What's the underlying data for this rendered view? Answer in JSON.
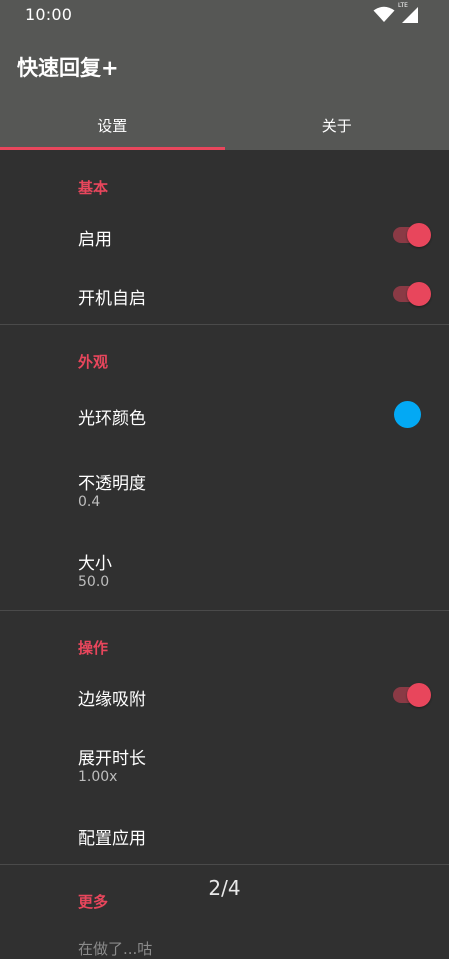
{
  "status_bar": {
    "time": "10:00",
    "network_label": "LTE",
    "icons": [
      "wifi-icon",
      "cell-signal-icon"
    ]
  },
  "app": {
    "title": "快速回复+",
    "accent_color": "#e8465c"
  },
  "tabs": [
    {
      "label": "设置",
      "selected": true
    },
    {
      "label": "关于",
      "selected": false
    }
  ],
  "sections": {
    "basic": {
      "header": "基本",
      "enable": {
        "title": "启用",
        "on": true
      },
      "autostart": {
        "title": "开机自启",
        "on": true
      }
    },
    "appearance": {
      "header": "外观",
      "halo_color": {
        "title": "光环颜色",
        "color": "#03a9f4"
      },
      "opacity": {
        "title": "不透明度",
        "value": "0.4"
      },
      "size": {
        "title": "大小",
        "value": "50.0"
      }
    },
    "operation": {
      "header": "操作",
      "edge_snap": {
        "title": "边缘吸附",
        "on": true
      },
      "expand_duration": {
        "title": "展开时长",
        "value": "1.00x"
      },
      "configure_apps": {
        "title": "配置应用"
      }
    },
    "more": {
      "header": "更多",
      "teaser": "在做了...咕"
    }
  },
  "page_indicator": "2/4"
}
